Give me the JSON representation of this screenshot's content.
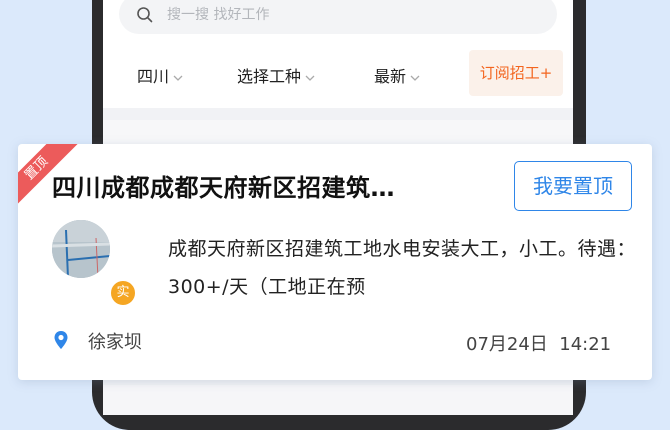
{
  "search": {
    "placeholder": "搜一搜 找好工作"
  },
  "filters": [
    {
      "label": "四川"
    },
    {
      "label": "选择工种"
    },
    {
      "label": "最新"
    }
  ],
  "subscribe_label": "订阅招工+",
  "colors": {
    "accent": "#2f86e8",
    "orange": "#f3651f",
    "ribbon": "#ec5b5b",
    "badge": "#f5a623"
  },
  "card": {
    "ribbon": "置顶",
    "title": "四川成都成都天府新区招建筑…",
    "pin_button": "我要置顶",
    "badge": "实",
    "description": "成都天府新区招建筑工地水电安装大工，小工。待遇：300+/天（工地正在预",
    "location": "徐家坝",
    "date": "07月24日",
    "time": "14:21"
  }
}
